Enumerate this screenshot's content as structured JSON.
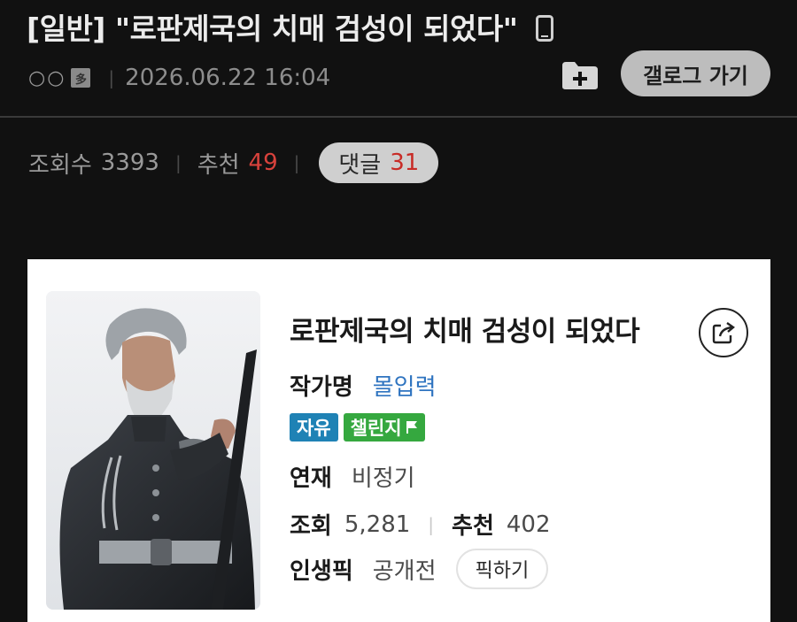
{
  "post": {
    "title": "[일반] \"로판제국의 치매 검성이 되었다\"",
    "author_dots": "○○",
    "author_badge": "多",
    "sep": "|",
    "datetime": "2026.06.22 16:04",
    "gallery_button": "갤로그 가기"
  },
  "stats": {
    "views_label": "조회수",
    "views_value": "3393",
    "recommend_label": "추천",
    "recommend_value": "49",
    "comments_label": "댓글",
    "comments_value": "31",
    "sep": "|"
  },
  "novel": {
    "title": "로판제국의 치매 검성이 되었다",
    "author_label": "작가명",
    "author_value": "몰입력",
    "tag_free": "자유",
    "tag_challenge": "챌린지",
    "serial_label": "연재",
    "serial_value": "비정기",
    "views_label": "조회",
    "views_value": "5,281",
    "recommend_label": "추천",
    "recommend_value": "402",
    "pick_label": "인생픽",
    "pick_value": "공개전",
    "pick_button": "픽하기",
    "sep": "|"
  },
  "icons": [
    "phone-icon",
    "folder-add-icon",
    "share-icon",
    "flag-icon"
  ],
  "colors": {
    "background": "#111111",
    "accent_red": "#d8423c",
    "link_blue": "#2f74c0",
    "tag_blue": "#1f82b5",
    "tag_green": "#35a83f"
  }
}
